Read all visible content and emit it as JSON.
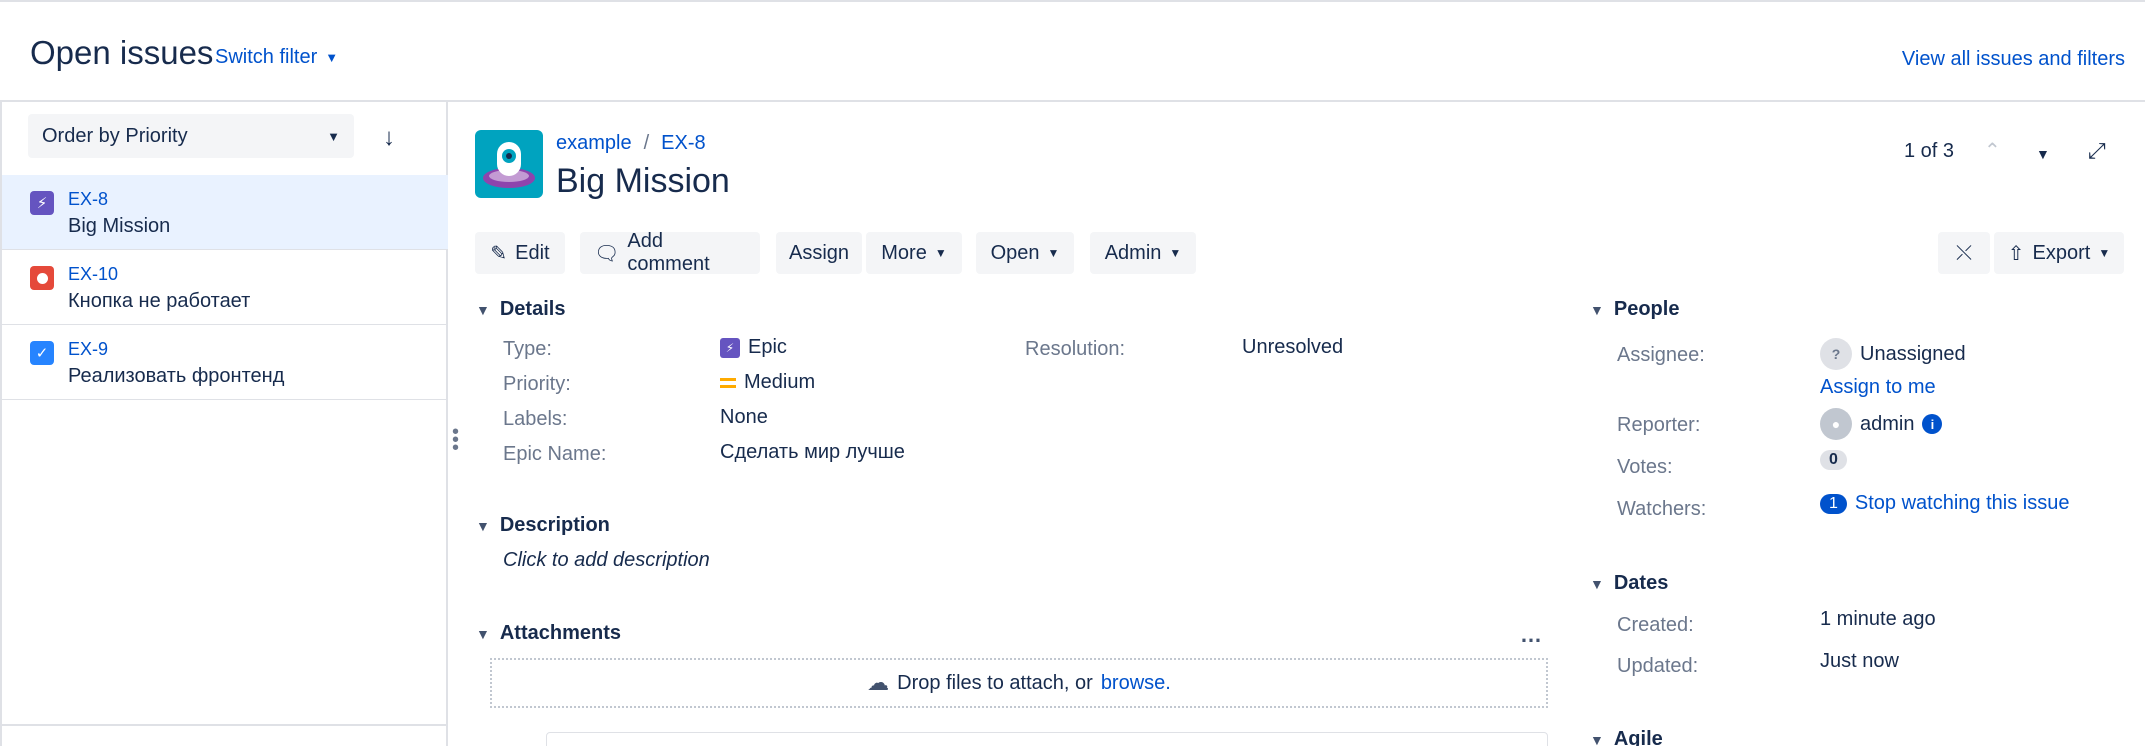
{
  "header": {
    "title": "Open issues",
    "switch_filter": "Switch filter",
    "view_all": "View all issues and filters"
  },
  "sidebar": {
    "order_by": "Order by Priority",
    "issues": [
      {
        "key": "EX-8",
        "summary": "Big Mission",
        "type": "epic",
        "color": "#6554c0"
      },
      {
        "key": "EX-10",
        "summary": "Кнопка не работает",
        "type": "bug",
        "color": "#e5493a"
      },
      {
        "key": "EX-9",
        "summary": "Реализовать фронтенд",
        "type": "task",
        "color": "#4bade8"
      }
    ]
  },
  "issue": {
    "project": "example",
    "key": "EX-8",
    "title": "Big Mission",
    "pager": "1 of 3"
  },
  "toolbar": {
    "edit": "Edit",
    "add_comment": "Add comment",
    "assign": "Assign",
    "more": "More",
    "open": "Open",
    "admin": "Admin",
    "export": "Export"
  },
  "details": {
    "heading": "Details",
    "type_label": "Type:",
    "type_value": "Epic",
    "priority_label": "Priority:",
    "priority_value": "Medium",
    "labels_label": "Labels:",
    "labels_value": "None",
    "epic_name_label": "Epic Name:",
    "epic_name_value": "Сделать мир лучше",
    "resolution_label": "Resolution:",
    "resolution_value": "Unresolved"
  },
  "description": {
    "heading": "Description",
    "placeholder": "Click to add description"
  },
  "attachments": {
    "heading": "Attachments",
    "drop_text": "Drop files to attach, or",
    "browse": "browse."
  },
  "people": {
    "heading": "People",
    "assignee_label": "Assignee:",
    "assignee_value": "Unassigned",
    "assign_to_me": "Assign to me",
    "reporter_label": "Reporter:",
    "reporter_value": "admin",
    "votes_label": "Votes:",
    "votes_value": "0",
    "watchers_label": "Watchers:",
    "watchers_count": "1",
    "watch_text": "Stop watching this issue"
  },
  "dates": {
    "heading": "Dates",
    "created_label": "Created:",
    "created_value": "1 minute ago",
    "updated_label": "Updated:",
    "updated_value": "Just now"
  },
  "agile": {
    "heading": "Agile"
  },
  "colors": {
    "link": "#0052cc",
    "selected_row": "#e9f2ff",
    "button_bg": "#f4f5f7",
    "epic": "#6554c0",
    "medium_priority": "#ffab00"
  }
}
